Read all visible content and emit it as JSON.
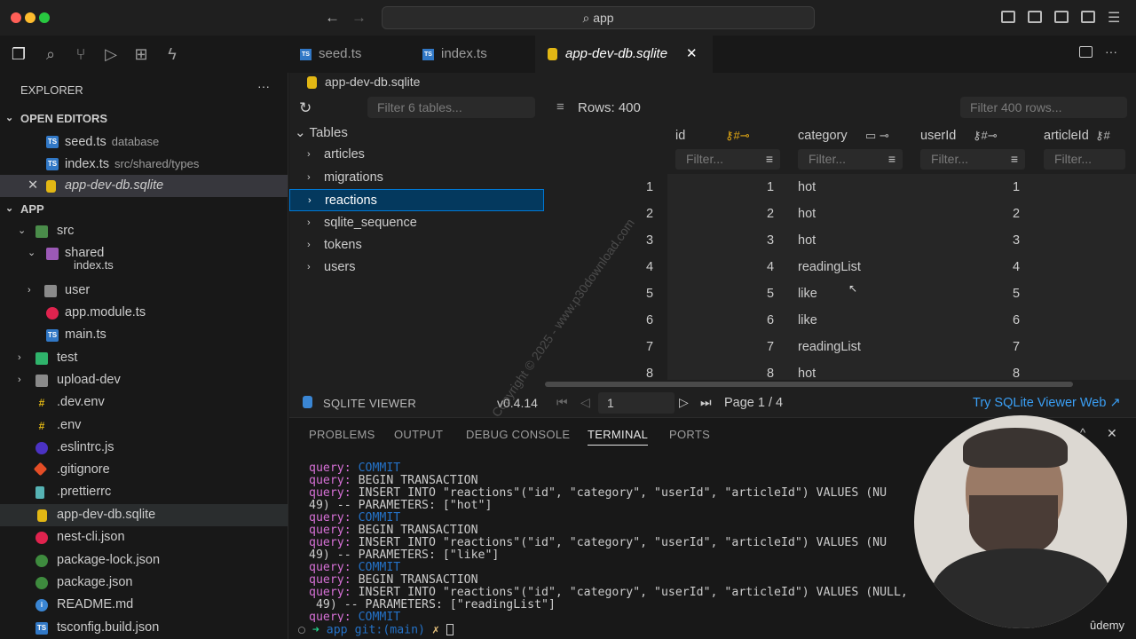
{
  "window": {
    "search_text": "app"
  },
  "explorer": {
    "title": "EXPLORER",
    "more": "···",
    "open_editors_header": "OPEN EDITORS",
    "open_editors": [
      {
        "name": "seed.ts",
        "desc": "database"
      },
      {
        "name": "index.ts",
        "desc": "src/shared/types"
      },
      {
        "name": "app-dev-db.sqlite",
        "desc": ""
      }
    ],
    "app_header": "APP",
    "tree": [
      "src",
      "shared",
      "index.ts",
      "user",
      "app.module.ts",
      "main.ts",
      "test",
      "upload-dev",
      ".dev.env",
      ".env",
      ".eslintrc.js",
      ".gitignore",
      ".prettierrc",
      "app-dev-db.sqlite",
      "nest-cli.json",
      "package-lock.json",
      "package.json",
      "README.md",
      "tsconfig.build.json"
    ]
  },
  "tabs": [
    {
      "label": "seed.ts"
    },
    {
      "label": "index.ts"
    },
    {
      "label": "app-dev-db.sqlite",
      "close": "✕"
    }
  ],
  "breadcrumb": "app-dev-db.sqlite",
  "sqlite": {
    "filter_tables_placeholder": "Filter 6 tables...",
    "tables_label": "Tables",
    "tables": [
      "articles",
      "migrations",
      "reactions",
      "sqlite_sequence",
      "tokens",
      "users"
    ],
    "rows_label": "Rows: 400",
    "filter_rows_placeholder": "Filter 400 rows...",
    "columns": [
      "id",
      "category",
      "userId",
      "articleId"
    ],
    "filter_placeholder": "Filter...",
    "rows": [
      {
        "n": "1",
        "id": "1",
        "category": "hot",
        "userId": "1"
      },
      {
        "n": "2",
        "id": "2",
        "category": "hot",
        "userId": "2"
      },
      {
        "n": "3",
        "id": "3",
        "category": "hot",
        "userId": "3"
      },
      {
        "n": "4",
        "id": "4",
        "category": "readingList",
        "userId": "4"
      },
      {
        "n": "5",
        "id": "5",
        "category": "like",
        "userId": "5"
      },
      {
        "n": "6",
        "id": "6",
        "category": "like",
        "userId": "6"
      },
      {
        "n": "7",
        "id": "7",
        "category": "readingList",
        "userId": "7"
      },
      {
        "n": "8",
        "id": "8",
        "category": "hot",
        "userId": "8"
      }
    ],
    "viewer_label": "SQLITE VIEWER",
    "version": "v0.4.14",
    "page_input": "1",
    "page_label": "Page 1 / 4",
    "try_link": "Try SQLite Viewer Web ↗"
  },
  "panel": {
    "tabs": [
      "PROBLEMS",
      "OUTPUT",
      "DEBUG CONSOLE",
      "TERMINAL",
      "PORTS"
    ],
    "terminal": [
      {
        "k": "query:",
        "t": " COMMIT"
      },
      {
        "k": "query:",
        "t": " BEGIN TRANSACTION"
      },
      {
        "k": "query:",
        "t": " INSERT INTO \"reactions\"(\"id\", \"category\", \"userId\", \"articleId\") VALUES (NU"
      },
      {
        "k": "",
        "t": "49) -- PARAMETERS: [\"hot\"]"
      },
      {
        "k": "query:",
        "t": " COMMIT"
      },
      {
        "k": "query:",
        "t": " BEGIN TRANSACTION"
      },
      {
        "k": "query:",
        "t": " INSERT INTO \"reactions\"(\"id\", \"category\", \"userId\", \"articleId\") VALUES (NU"
      },
      {
        "k": "",
        "t": "49) -- PARAMETERS: [\"like\"]"
      },
      {
        "k": "query:",
        "t": " COMMIT"
      },
      {
        "k": "query:",
        "t": " BEGIN TRANSACTION"
      },
      {
        "k": "query:",
        "t": " INSERT INTO \"reactions\"(\"id\", \"category\", \"userId\", \"articleId\") VALUES (NULL,"
      },
      {
        "k": "",
        "t": " 49) -- PARAMETERS: [\"readingList\"]"
      },
      {
        "k": "query:",
        "t": " COMMIT"
      }
    ],
    "prompt": {
      "arrow": "➜",
      "dir": "app",
      "git": "git:(main)",
      "x": "✗"
    }
  },
  "watermark": "Copyright © 2025 - www.p30download.com",
  "udemy": "ûdemy"
}
